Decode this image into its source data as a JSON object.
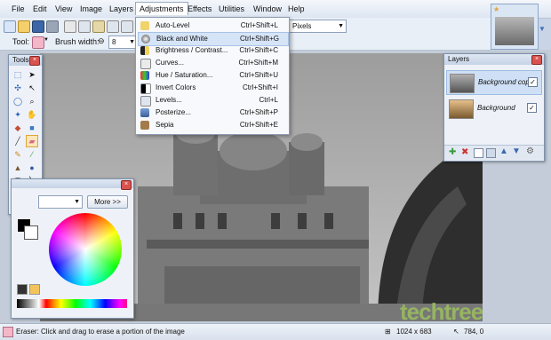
{
  "menu": {
    "items": [
      "File",
      "Edit",
      "View",
      "Image",
      "Layers",
      "Adjustments",
      "Effects",
      "Utilities",
      "Window",
      "Help"
    ],
    "active": "Adjustments"
  },
  "toolbar": {
    "tool_label": "Tool:",
    "brush_width_label": "Brush width:",
    "brush_width_value": "8",
    "units_value": "Pixels"
  },
  "adjustments_menu": [
    {
      "label": "Auto-Level",
      "shortcut": "Ctrl+Shift+L"
    },
    {
      "label": "Black and White",
      "shortcut": "Ctrl+Shift+G"
    },
    {
      "label": "Brightness / Contrast...",
      "shortcut": "Ctrl+Shift+C"
    },
    {
      "label": "Curves...",
      "shortcut": "Ctrl+Shift+M"
    },
    {
      "label": "Hue / Saturation...",
      "shortcut": "Ctrl+Shift+U"
    },
    {
      "label": "Invert Colors",
      "shortcut": "Ctrl+Shift+I"
    },
    {
      "label": "Levels...",
      "shortcut": "Ctrl+L"
    },
    {
      "label": "Posterize...",
      "shortcut": "Ctrl+Shift+P"
    },
    {
      "label": "Sepia",
      "shortcut": "Ctrl+Shift+E"
    }
  ],
  "tools_panel": {
    "title": "Tools"
  },
  "colors_panel": {
    "more_button": "More >>"
  },
  "layers_panel": {
    "title": "Layers",
    "layers": [
      {
        "name": "Background copy",
        "visible": true
      },
      {
        "name": "Background",
        "visible": true
      }
    ]
  },
  "status": {
    "message": "Eraser: Click and drag to erase a portion of the image",
    "image_size": "1024 x 683",
    "cursor_pos": "784, 0"
  },
  "watermark": "techtree",
  "colors": {
    "accent": "#3f6fb5",
    "highlight": "#d6e4f7"
  }
}
